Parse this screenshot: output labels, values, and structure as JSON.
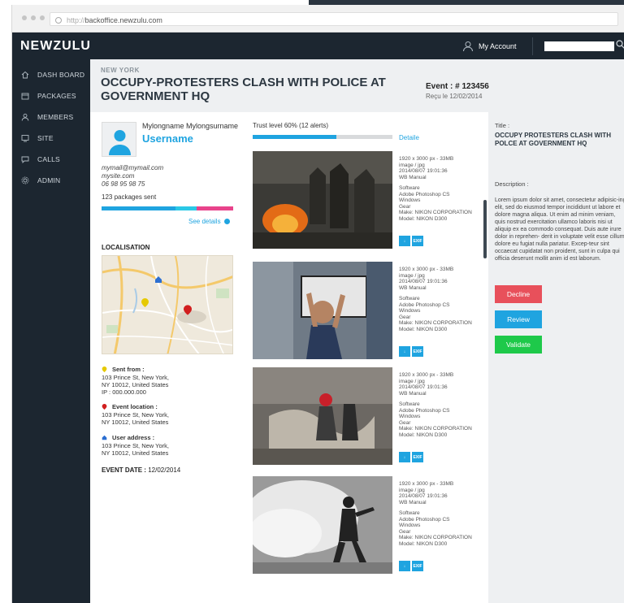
{
  "browser": {
    "url_scheme": "http://",
    "url_host": "backoffice.newzulu.com"
  },
  "topnav": {
    "logo": "NEWZULU",
    "account_label": "My Account",
    "search_placeholder": ""
  },
  "sidebar": {
    "items": [
      {
        "label": "DASH BOARD",
        "icon": "home-icon"
      },
      {
        "label": "PACKAGES",
        "icon": "inbox-icon"
      },
      {
        "label": "MEMBERS",
        "icon": "user-icon"
      },
      {
        "label": "SITE",
        "icon": "monitor-icon"
      },
      {
        "label": "CALLS",
        "icon": "chat-icon"
      },
      {
        "label": "ADMIN",
        "icon": "gear-icon"
      }
    ]
  },
  "header": {
    "city": "NEW YORK",
    "title": "OCCUPY-PROTESTERS CLASH WITH POLICE AT GOVERNMENT HQ",
    "event_id": "Event : # 123456",
    "received": "Reçu le 12/02/2014"
  },
  "profile": {
    "fullname": "Mylongname Mylongsurname",
    "username": "Username",
    "email": "mymail@mymail.com",
    "site": "mysite.com",
    "phone": "06 98 95 98 75",
    "packages_sent": "123 packages sent",
    "see_details": "See details"
  },
  "colors": {
    "accent": "#1fa4e0",
    "pink": "#e8438b",
    "cyan": "#2ac8e6",
    "decline": "#e8505b",
    "review": "#1fa4e0",
    "validate": "#1ec94a"
  },
  "location": {
    "title": "LOCALISATION",
    "sent_from_title": "Sent from :",
    "sent_from_lines": [
      "103 Prince St, New York,",
      "NY 10012, United States",
      "IP : 000.000.000"
    ],
    "event_location_title": "Event location :",
    "event_location_lines": [
      "103 Prince St, New York,",
      "NY 10012, United States"
    ],
    "user_address_title": "User address :",
    "user_address_lines": [
      "103 Prince St, New York,",
      "NY 10012, United States"
    ],
    "event_date_label": "EVENT DATE :",
    "event_date_value": "12/02/2014"
  },
  "trust": {
    "label": "Trust level 60% (12 alerts)",
    "level": 0.6,
    "detail": "Detaile"
  },
  "photos": [
    {
      "meta": [
        "1920 x 3000 px - 33MB",
        "image / jpg",
        "2014/08/07 19:01:36",
        "WB Manual"
      ],
      "meta2": [
        "Software",
        "Adobe Photoshop CS",
        "Windows",
        "Gear",
        "Make: NIKON CORPORATION",
        "Model: NIKON D300"
      ]
    },
    {
      "meta": [
        "1920 x 3000 px - 33MB",
        "image / jpg",
        "2014/08/07 19:01:36",
        "WB Manual"
      ],
      "meta2": [
        "Software",
        "Adobe Photoshop CS",
        "Windows",
        "Gear",
        "Make: NIKON CORPORATION",
        "Model: NIKON D300"
      ]
    },
    {
      "meta": [
        "1920 x 3000 px - 33MB",
        "image / jpg",
        "2014/08/07 19:01:36",
        "WB Manual"
      ],
      "meta2": [
        "Software",
        "Adobe Photoshop CS",
        "Windows",
        "Gear",
        "Make: NIKON CORPORATION",
        "Model: NIKON D300"
      ]
    },
    {
      "meta": [
        "1920 x 3000 px - 33MB",
        "image / jpg",
        "2014/08/07 19:01:36",
        "WB Manual"
      ],
      "meta2": [
        "Software",
        "Adobe Photoshop CS",
        "Windows",
        "Gear",
        "Make: NIKON CORPORATION",
        "Model: NIKON D300"
      ]
    }
  ],
  "photo_buttons": {
    "download": "↓",
    "exif": "EXIF"
  },
  "details_panel": {
    "title_label": "Title :",
    "title": "OCCUPY PROTESTERS CLASH WITH POLCE AT GOVERNMENT HQ",
    "description_label": "Description :",
    "description": "Lorem ipsum dolor sit amet, consectetur adipisic-ing elit, sed do eiusmod tempor incididunt ut labore et dolore magna aliqua. Ut enim ad minim veniam, quis nostrud exercitation ullamco laboris nisi ut aliquip ex ea commodo consequat. Duis aute irure dolor in reprehen- derit in voluptate velit esse cillum dolore eu fugiat nulla pariatur. Excep-teur sint occaecat cupidatat non proident, sunt in culpa qui officia deserunt mollit anim id est laborum.",
    "decline": "Decline",
    "review": "Review",
    "validate": "Validate"
  }
}
